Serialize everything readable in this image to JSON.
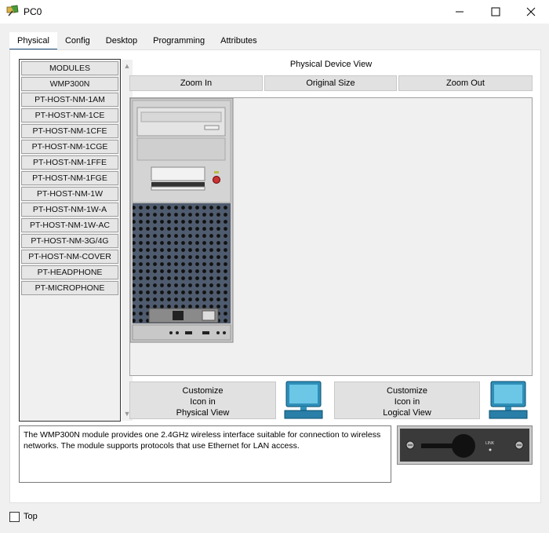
{
  "window": {
    "title": "PC0"
  },
  "tabs": [
    {
      "label": "Physical",
      "active": true
    },
    {
      "label": "Config"
    },
    {
      "label": "Desktop"
    },
    {
      "label": "Programming"
    },
    {
      "label": "Attributes"
    }
  ],
  "modules": [
    "MODULES",
    "WMP300N",
    "PT-HOST-NM-1AM",
    "PT-HOST-NM-1CE",
    "PT-HOST-NM-1CFE",
    "PT-HOST-NM-1CGE",
    "PT-HOST-NM-1FFE",
    "PT-HOST-NM-1FGE",
    "PT-HOST-NM-1W",
    "PT-HOST-NM-1W-A",
    "PT-HOST-NM-1W-AC",
    "PT-HOST-NM-3G/4G",
    "PT-HOST-NM-COVER",
    "PT-HEADPHONE",
    "PT-MICROPHONE"
  ],
  "physical_view": {
    "label": "Physical Device View",
    "zoom_in": "Zoom In",
    "original_size": "Original Size",
    "zoom_out": "Zoom Out"
  },
  "customize_physical": {
    "line1": "Customize",
    "line2": "Icon in",
    "line3": "Physical View"
  },
  "customize_logical": {
    "line1": "Customize",
    "line2": "Icon in",
    "line3": "Logical View"
  },
  "description": "The WMP300N module provides one 2.4GHz wireless interface suitable for connection to wireless networks. The module supports protocols that use Ethernet for LAN access.",
  "module_image": {
    "link_label": "LINK"
  },
  "footer": {
    "top_label": "Top",
    "top_checked": false
  },
  "icons": [
    "packet-tracer-icon",
    "minimize-icon",
    "maximize-icon",
    "close-icon",
    "monitor-icon"
  ]
}
